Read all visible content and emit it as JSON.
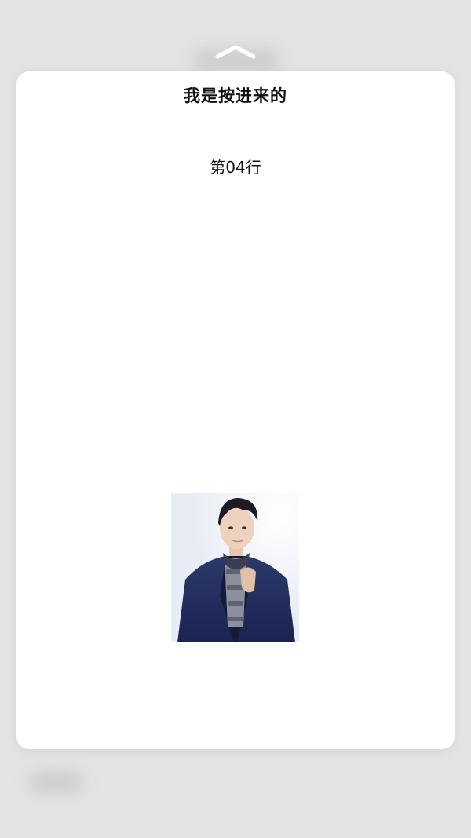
{
  "peek": {
    "title": "我是按进来的",
    "row_label": "第04行",
    "photo": "portrait-photo",
    "swipe_indicator": "chevron-up-icon"
  },
  "colors": {
    "background": "#e4e4e4",
    "sheet": "#ffffff",
    "text": "#111111"
  }
}
